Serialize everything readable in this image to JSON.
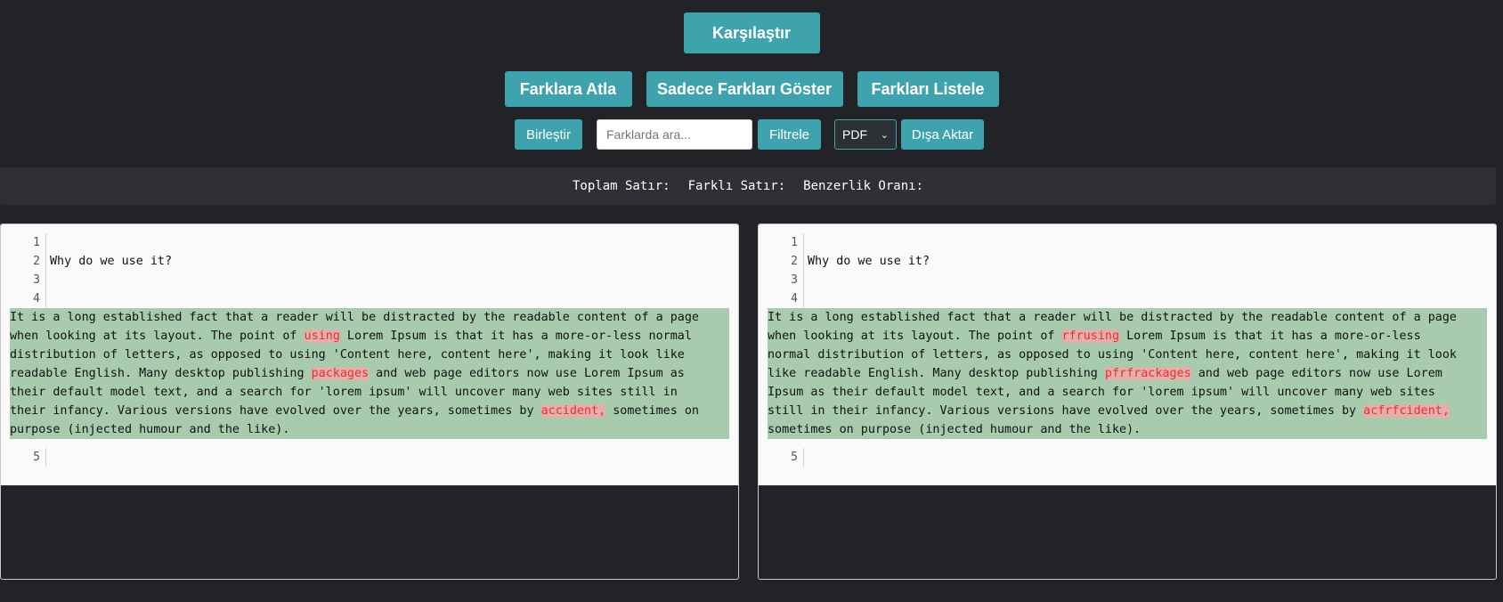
{
  "toolbar": {
    "compare_label": "Karşılaştır",
    "jump_label": "Farklara Atla",
    "only_diff_label": "Sadece Farkları Göster",
    "list_label": "Farkları Listele",
    "merge_label": "Birleştir",
    "search_placeholder": "Farklarda ara...",
    "filter_label": "Filtrele",
    "format_selected": "PDF",
    "export_label": "Dışa Aktar"
  },
  "stats": {
    "total_label": "Toplam Satır:",
    "diff_label": "Farklı Satır:",
    "similarity_label": "Benzerlik Oranı:"
  },
  "left": {
    "line_numbers": [
      "1",
      "2",
      "3",
      "4",
      "5"
    ],
    "line2": "Why do we use it?",
    "block": [
      [
        {
          "t": "It is a long established fact that a reader will be distracted by the readable content of a page"
        }
      ],
      [
        {
          "t": "when looking at its layout. The point of "
        },
        {
          "t": "using",
          "hl": true
        },
        {
          "t": " Lorem Ipsum is that it has a more-or-less normal"
        }
      ],
      [
        {
          "t": "distribution of letters, as opposed to using 'Content here, content here', making it look like"
        }
      ],
      [
        {
          "t": "readable English. Many desktop publishing "
        },
        {
          "t": "packages",
          "hl": true
        },
        {
          "t": " and web page editors now use Lorem Ipsum as"
        }
      ],
      [
        {
          "t": "their default model text, and a search for 'lorem ipsum' will uncover many web sites still in"
        }
      ],
      [
        {
          "t": "their infancy. Various versions have evolved over the years, sometimes by "
        },
        {
          "t": "accident,",
          "hl": true
        },
        {
          "t": " sometimes on"
        }
      ],
      [
        {
          "t": "purpose (injected humour and the like)."
        }
      ]
    ]
  },
  "right": {
    "line_numbers": [
      "1",
      "2",
      "3",
      "4",
      "5"
    ],
    "line2": "Why do we use it?",
    "block": [
      [
        {
          "t": "It is a long established fact that a reader will be distracted by the readable content of a page"
        }
      ],
      [
        {
          "t": "when looking at its layout. The point of "
        },
        {
          "t": "rfrusing",
          "hl": true
        },
        {
          "t": " Lorem Ipsum is that it has a more-or-less"
        }
      ],
      [
        {
          "t": "normal distribution of letters, as opposed to using 'Content here, content here', making it look"
        }
      ],
      [
        {
          "t": "like readable English. Many desktop publishing "
        },
        {
          "t": "pfrfrackages",
          "hl": true
        },
        {
          "t": " and web page editors now use Lorem"
        }
      ],
      [
        {
          "t": "Ipsum as their default model text, and a search for 'lorem ipsum' will uncover many web sites"
        }
      ],
      [
        {
          "t": "still in their infancy. Various versions have evolved over the years, sometimes by "
        },
        {
          "t": "acfrfcident,",
          "hl": true
        }
      ],
      [
        {
          "t": "sometimes on purpose (injected humour and the like)."
        }
      ]
    ]
  }
}
